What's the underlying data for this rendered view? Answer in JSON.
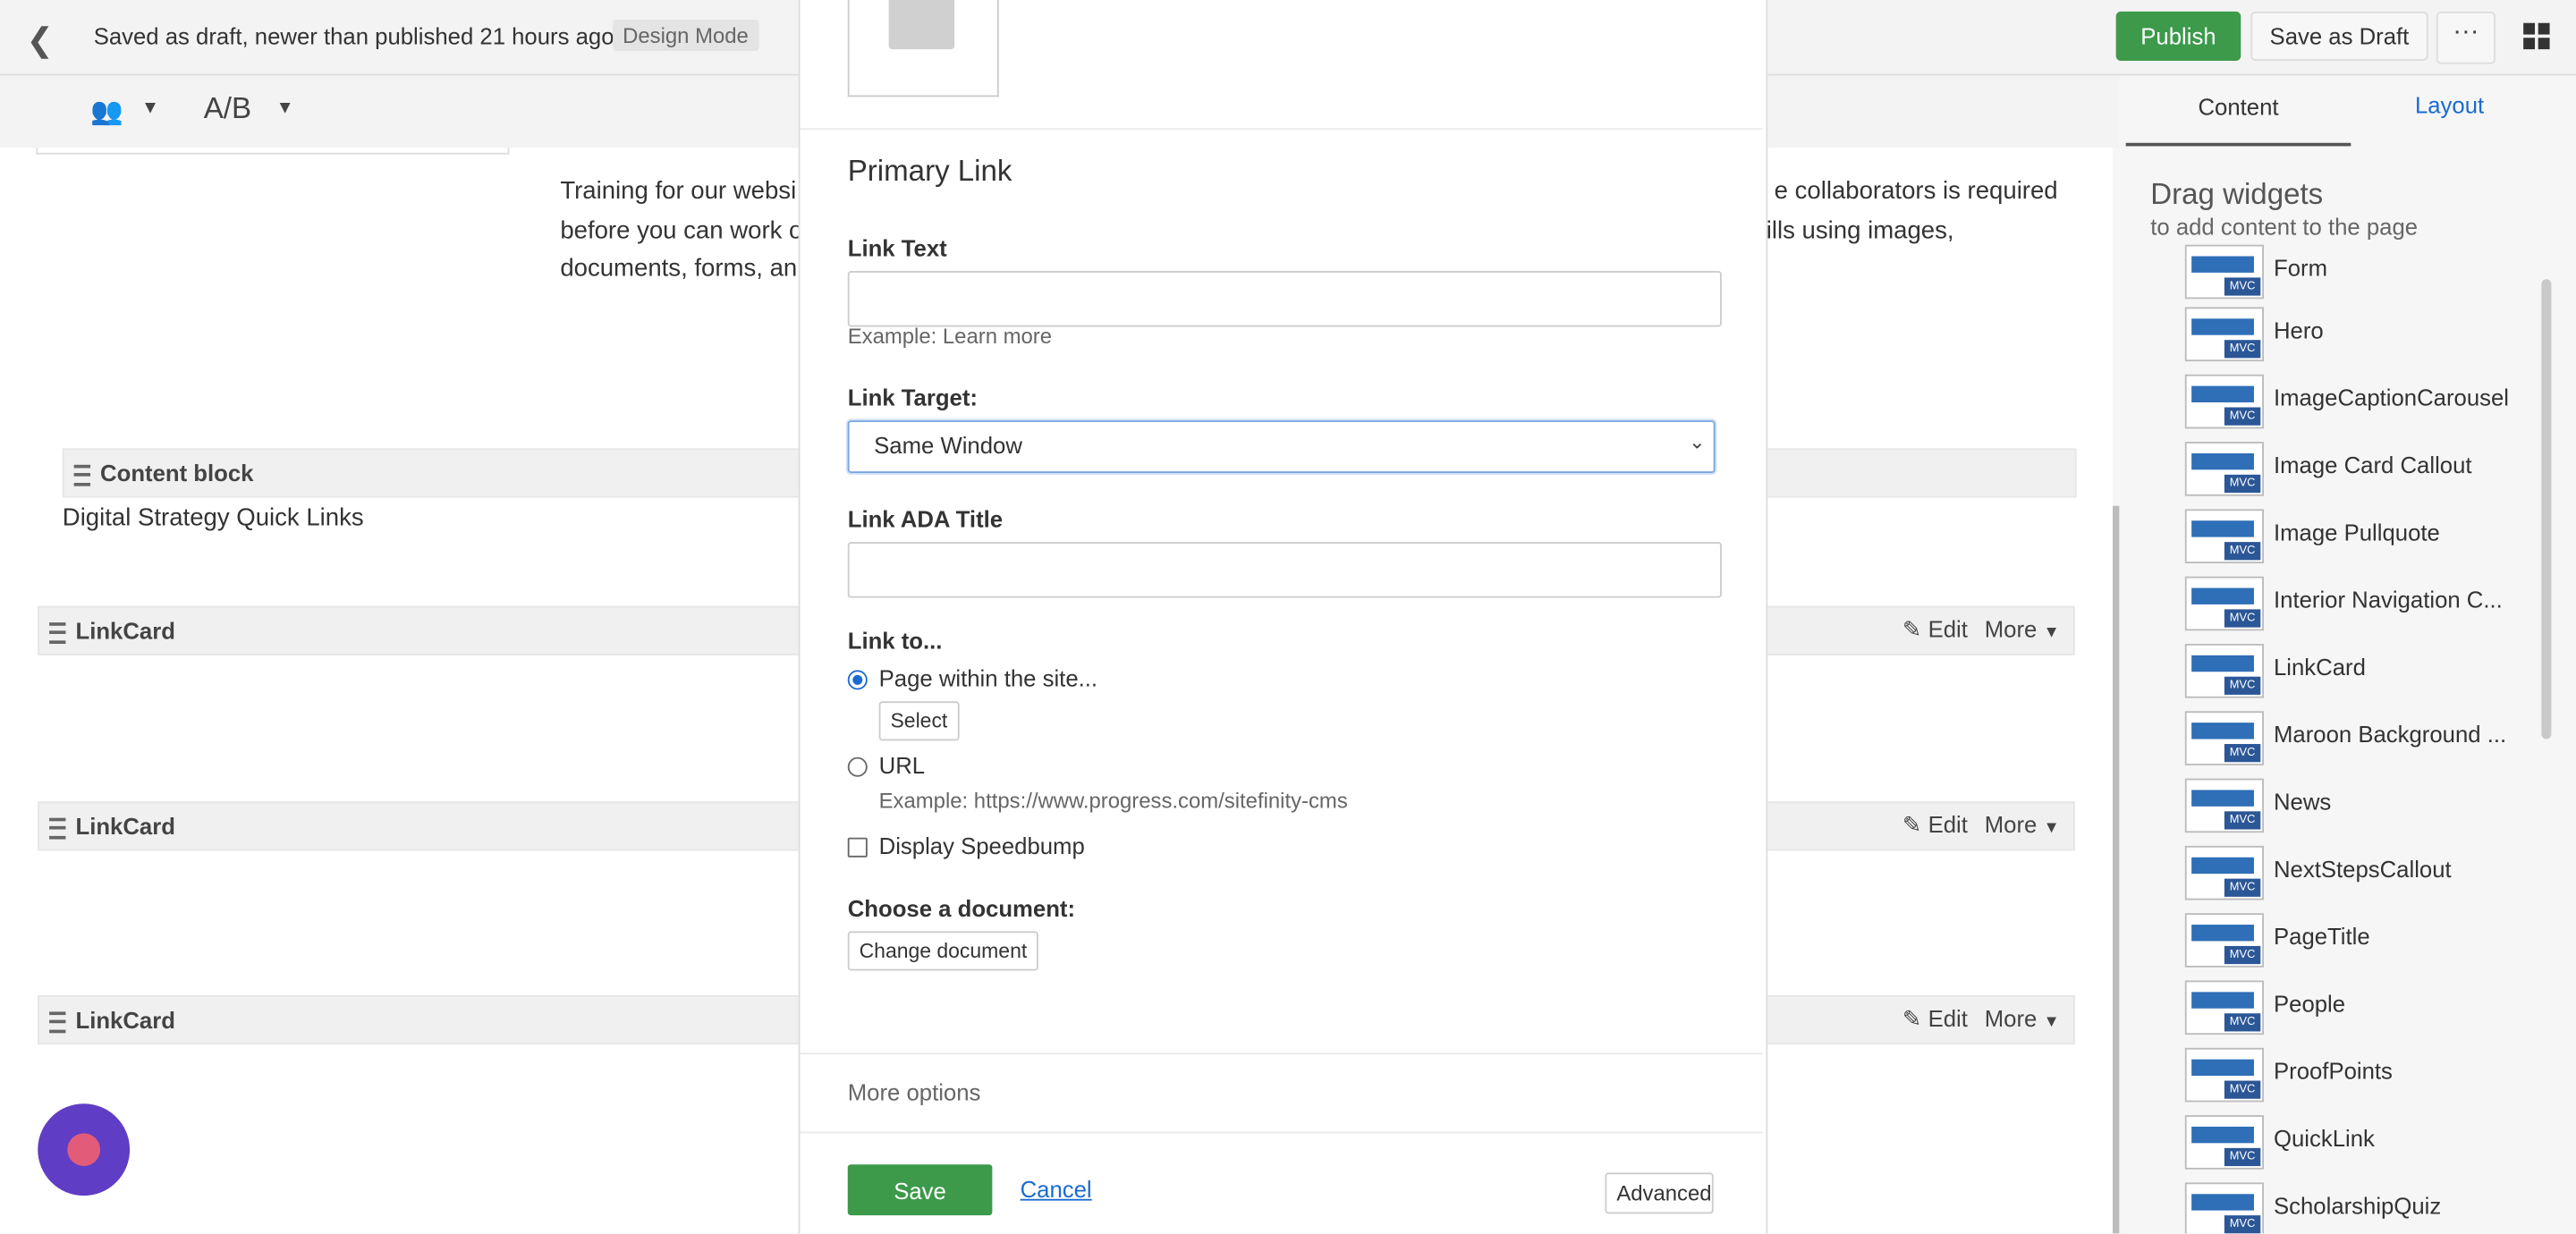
{
  "topbar": {
    "back_glyph": "❮",
    "status": "Saved as draft, newer than published 21 hours ago",
    "mode": "Design Mode",
    "publish": "Publish",
    "save_draft": "Save as Draft",
    "more": "···"
  },
  "toolbar2": {
    "people_glyph": "👥",
    "caret": "▼",
    "ab": "A/B"
  },
  "canvas": {
    "paragraph": "Training for our websi                                                                  e collaborators is required before you can work o                                                              tills using images, documents, forms, an",
    "para_line1a": "Training for our websi",
    "para_line1b": "e collaborators is required",
    "para_line2a": "before you can work o",
    "para_line2b": "tills using images,",
    "para_line3a": "documents, forms, an",
    "content_block_label": "Content block",
    "quick_links": "Digital Strategy Quick Links",
    "linkcards": [
      {
        "label": "LinkCard",
        "edit": "Edit",
        "more": "More"
      },
      {
        "label": "LinkCard",
        "edit": "Edit",
        "more": "More"
      },
      {
        "label": "LinkCard",
        "edit": "Edit",
        "more": "More"
      }
    ],
    "edit_glyph": "✎",
    "caret": "▼"
  },
  "sidebar": {
    "tab_content": "Content",
    "tab_layout": "Layout",
    "drag_title": "Drag widgets",
    "drag_sub": "to add content to the page",
    "mvc": "MVC",
    "widgets": [
      "Form",
      "Hero",
      "ImageCaptionCarousel",
      "Image Card Callout",
      "Image Pullquote",
      "Interior Navigation C...",
      "LinkCard",
      "Maroon Background ...",
      "News",
      "NextStepsCallout",
      "PageTitle",
      "People",
      "ProofPoints",
      "QuickLink",
      "ScholarshipQuiz"
    ],
    "collapse_glyph": "▶"
  },
  "modal": {
    "primary_link": "Primary Link",
    "link_text_label": "Link Text",
    "link_text_value": "",
    "link_text_hint": "Example: Learn more",
    "link_target_label": "Link Target:",
    "link_target_value": "Same Window",
    "link_target_caret": "⌄",
    "ada_label": "Link ADA Title",
    "ada_value": "",
    "link_to_label": "Link to...",
    "opt_page": "Page within the site...",
    "select_btn": "Select",
    "opt_url": "URL",
    "url_hint": "Example: https://www.progress.com/sitefinity-cms",
    "speedbump": "Display Speedbump",
    "choose_doc": "Choose a document:",
    "change_doc": "Change document",
    "more_options": "More options",
    "save": "Save",
    "cancel": "Cancel",
    "advanced": "Advanced"
  },
  "colors": {
    "accent_green": "#3c9a4a",
    "link_blue": "#1a6bd1",
    "widget_blue": "#2e6fb7"
  }
}
